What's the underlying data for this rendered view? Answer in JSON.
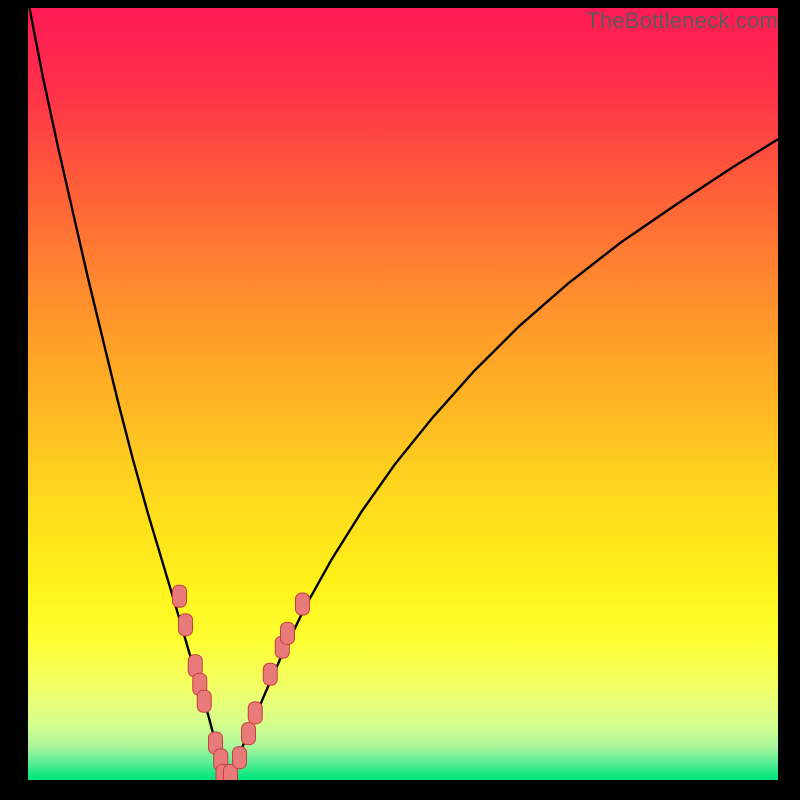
{
  "watermark": "TheBottleneck.com",
  "palette": {
    "frame": "#000000",
    "curve": "#000000",
    "marker_fill": "#e97a7a",
    "marker_stroke": "#c43f3f",
    "bottom_band": "#00e57c"
  },
  "gradient_stops": [
    {
      "offset": 0.0,
      "color": "#ff1a55"
    },
    {
      "offset": 0.1,
      "color": "#ff2f4a"
    },
    {
      "offset": 0.22,
      "color": "#ff5a3a"
    },
    {
      "offset": 0.36,
      "color": "#ff8a2e"
    },
    {
      "offset": 0.5,
      "color": "#ffb224"
    },
    {
      "offset": 0.63,
      "color": "#ffd81e"
    },
    {
      "offset": 0.75,
      "color": "#fff31a"
    },
    {
      "offset": 0.82,
      "color": "#feff33"
    },
    {
      "offset": 0.88,
      "color": "#f2ff66"
    },
    {
      "offset": 0.925,
      "color": "#d8ff8c"
    },
    {
      "offset": 0.955,
      "color": "#aef79a"
    },
    {
      "offset": 0.975,
      "color": "#66ef97"
    },
    {
      "offset": 0.992,
      "color": "#18e884"
    },
    {
      "offset": 1.0,
      "color": "#00e57c"
    }
  ],
  "chart_data": {
    "type": "line",
    "title": "",
    "xlabel": "",
    "ylabel": "",
    "xlim": [
      0,
      100
    ],
    "ylim": [
      0,
      100
    ],
    "grid": false,
    "series": [
      {
        "name": "curve-left",
        "x": [
          0.2,
          2,
          4,
          6,
          8,
          10,
          12,
          14,
          16,
          18,
          20,
          21.5,
          23,
          24,
          24.8,
          25.4,
          25.9,
          26.2,
          26.5
        ],
        "y": [
          100,
          91,
          82,
          73.5,
          65,
          57,
          49,
          41.5,
          34.5,
          28,
          21.5,
          16.5,
          12,
          8.5,
          5.6,
          3.4,
          1.8,
          0.8,
          0.1
        ]
      },
      {
        "name": "curve-right",
        "x": [
          26.5,
          27.2,
          28.2,
          29.6,
          31.6,
          34,
          37,
          40.5,
          44.5,
          49,
          54,
          59.5,
          65.5,
          72,
          79,
          86.5,
          94,
          100
        ],
        "y": [
          0.1,
          1.2,
          3.4,
          6.6,
          11.2,
          16.5,
          22.5,
          28.6,
          34.8,
          41,
          47,
          53,
          58.8,
          64.3,
          69.6,
          74.6,
          79.4,
          83
        ]
      }
    ],
    "markers": [
      {
        "x": 20.2,
        "y": 23.8
      },
      {
        "x": 21.0,
        "y": 20.1
      },
      {
        "x": 22.3,
        "y": 14.8
      },
      {
        "x": 22.9,
        "y": 12.4
      },
      {
        "x": 23.5,
        "y": 10.2
      },
      {
        "x": 25.0,
        "y": 4.8
      },
      {
        "x": 25.7,
        "y": 2.6
      },
      {
        "x": 26.0,
        "y": 0.6
      },
      {
        "x": 27.0,
        "y": 0.6
      },
      {
        "x": 28.2,
        "y": 2.9
      },
      {
        "x": 29.4,
        "y": 6.0
      },
      {
        "x": 30.3,
        "y": 8.7
      },
      {
        "x": 32.3,
        "y": 13.7
      },
      {
        "x": 33.9,
        "y": 17.2
      },
      {
        "x": 34.6,
        "y": 19.0
      },
      {
        "x": 36.6,
        "y": 22.8
      }
    ]
  }
}
